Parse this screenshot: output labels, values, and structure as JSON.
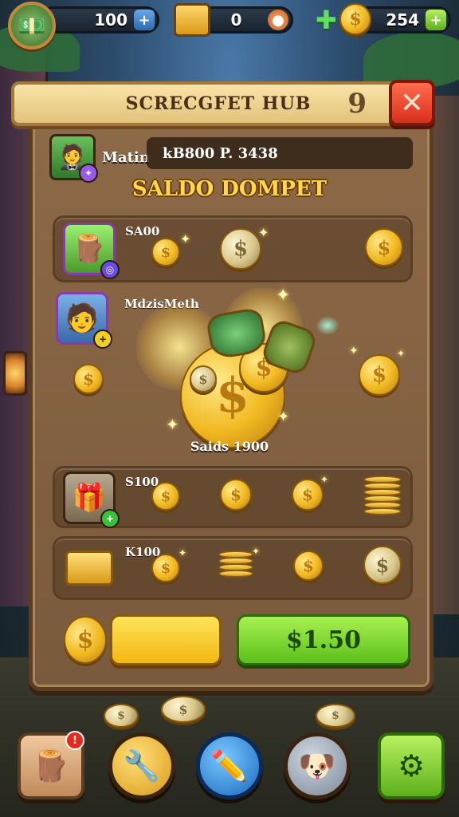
{
  "topbar": {
    "resource_1": {
      "value": "100",
      "icon": "cash-bundle-icon"
    },
    "resource_2": {
      "value": "0",
      "icon": "treasure-chest-icon"
    },
    "resource_3": {
      "value": "254",
      "icon": "gold-coin-icon"
    }
  },
  "panel": {
    "title": "SCRECGFET HUB",
    "level": "9",
    "close_label": "✕"
  },
  "player": {
    "name": "Matin",
    "info": "kB800 P. 3438"
  },
  "wallet": {
    "title": "SALDO DOMPET",
    "balance": "Saids 1900"
  },
  "slots": [
    {
      "label": "SA00",
      "icon": "wood-log-icon"
    },
    {
      "label": "MdzisMeth",
      "icon": "character-portrait-icon"
    },
    {
      "label": "S100",
      "icon": "gift-box-icon"
    },
    {
      "label": "K100",
      "icon": "gold-bars-icon"
    }
  ],
  "actions": {
    "buy_label": "$1.50",
    "yellow_label": ""
  },
  "nav": {
    "notif_count": "!",
    "items": [
      "inventory",
      "tools",
      "edit",
      "pet",
      "settings"
    ]
  },
  "colors": {
    "accent_gold": "#f0b820",
    "button_green": "#5cc01a",
    "close_red": "#d8301c",
    "panel_brown": "#7a5a3d"
  }
}
